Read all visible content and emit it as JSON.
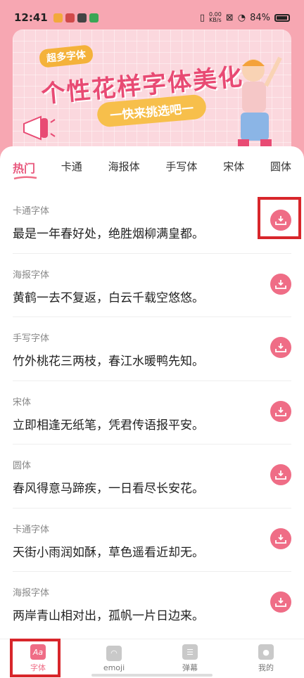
{
  "status": {
    "time": "12:41",
    "net_speed": "0.00\nKB/s",
    "battery": "84%"
  },
  "banner": {
    "tag": "超多字体",
    "title": "个性花样字体美化",
    "subtitle": "一快来挑选吧一"
  },
  "tabs": [
    "热门",
    "卡通",
    "海报体",
    "手写体",
    "宋体",
    "圆体"
  ],
  "items": [
    {
      "category": "卡通字体",
      "text": "最是一年春好处，绝胜烟柳满皇都。"
    },
    {
      "category": "海报字体",
      "text": "黄鹤一去不复返，白云千载空悠悠。"
    },
    {
      "category": "手写字体",
      "text": "竹外桃花三两枝，春江水暖鸭先知。"
    },
    {
      "category": "宋体",
      "text": "立即相逢无纸笔，凭君传语报平安。"
    },
    {
      "category": "圆体",
      "text": "春风得意马蹄疾，一日看尽长安花。"
    },
    {
      "category": "卡通字体",
      "text": "天街小雨润如酥，草色遥看近却无。"
    },
    {
      "category": "海报字体",
      "text": "两岸青山相对出，孤帆一片日边来。"
    }
  ],
  "nav": [
    {
      "label": "字体",
      "icon": "Aa"
    },
    {
      "label": "emoji",
      "icon": ""
    },
    {
      "label": "弹幕",
      "icon": ""
    },
    {
      "label": "我的",
      "icon": ""
    }
  ],
  "colors": {
    "accent": "#ef6d86",
    "highlight": "#d8262b",
    "banner_bg": "#fbd8de",
    "page_bg": "#f7a7b2"
  }
}
